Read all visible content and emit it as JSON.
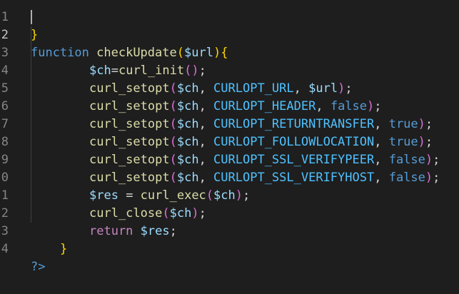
{
  "editor": {
    "language": "php",
    "theme": "dark",
    "lines": [
      {
        "num": "1",
        "text": "}"
      },
      {
        "num": "2",
        "text": "function checkUpdate($url){"
      },
      {
        "num": "3",
        "text": "$ch=curl_init();"
      },
      {
        "num": "4",
        "text": "curl_setopt($ch, CURLOPT_URL, $url);"
      },
      {
        "num": "5",
        "text": "curl_setopt($ch, CURLOPT_HEADER, false);"
      },
      {
        "num": "6",
        "text": "curl_setopt($ch, CURLOPT_RETURNTRANSFER, true);"
      },
      {
        "num": "7",
        "text": "curl_setopt($ch, CURLOPT_FOLLOWLOCATION, true);"
      },
      {
        "num": "8",
        "text": "curl_setopt($ch, CURLOPT_SSL_VERIFYPEER, false);"
      },
      {
        "num": "9",
        "text": "curl_setopt($ch, CURLOPT_SSL_VERIFYHOST, false);"
      },
      {
        "num": "0",
        "text": "$res = curl_exec($ch);"
      },
      {
        "num": "1",
        "text": "curl_close($ch);"
      },
      {
        "num": "2",
        "text": "return $res;"
      },
      {
        "num": "3",
        "text": "}"
      },
      {
        "num": "4",
        "text": "?>"
      }
    ],
    "tokens": {
      "l1_brace": "}",
      "l2_function": "function",
      "l2_name": "checkUpdate",
      "l2_open": "(",
      "l2_param": "$url",
      "l2_close": ")",
      "l2_brace": "{",
      "l3_var": "$ch",
      "l3_eq": "=",
      "l3_fn": "curl_init",
      "l3_parens": "()",
      "l3_semi": ";",
      "setopt": "curl_setopt",
      "open": "(",
      "close": ")",
      "semi": ";",
      "comma": ", ",
      "ch": "$ch",
      "url": "$url",
      "c_url": "CURLOPT_URL",
      "c_header": "CURLOPT_HEADER",
      "c_return": "CURLOPT_RETURNTRANSFER",
      "c_follow": "CURLOPT_FOLLOWLOCATION",
      "c_peer": "CURLOPT_SSL_VERIFYPEER",
      "c_host": "CURLOPT_SSL_VERIFYHOST",
      "false": "false",
      "true": "true",
      "l10_res": "$res",
      "l10_eq": " = ",
      "l10_fn": "curl_exec",
      "l11_fn": "curl_close",
      "l12_return": "return",
      "l12_res": " $res",
      "l13_brace": "}",
      "l14_tag": "?>"
    }
  }
}
